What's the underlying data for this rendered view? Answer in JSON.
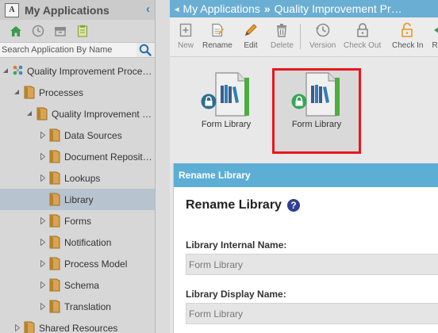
{
  "left_panel": {
    "title": "My Applications",
    "search": {
      "placeholder": "Search Application By Name",
      "value": ""
    },
    "icons": [
      "home-icon",
      "recent-icon",
      "archive-icon",
      "clipboard-icon"
    ],
    "tree": [
      {
        "label": "Quality Improvement Proce…",
        "level": 0,
        "expanded": true,
        "icon": "app-icon"
      },
      {
        "label": "Processes",
        "level": 1,
        "expanded": true,
        "icon": "folder-icon"
      },
      {
        "label": "Quality Improvement …",
        "level": 2,
        "expanded": true,
        "icon": "folder-icon"
      },
      {
        "label": "Data Sources",
        "level": 3,
        "expanded": false,
        "icon": "folder-icon"
      },
      {
        "label": "Document Reposit…",
        "level": 3,
        "expanded": false,
        "icon": "folder-icon"
      },
      {
        "label": "Lookups",
        "level": 3,
        "expanded": false,
        "icon": "folder-icon"
      },
      {
        "label": "Library",
        "level": 3,
        "expanded": null,
        "icon": "folder-icon",
        "selected": true
      },
      {
        "label": "Forms",
        "level": 3,
        "expanded": false,
        "icon": "folder-icon"
      },
      {
        "label": "Notification",
        "level": 3,
        "expanded": false,
        "icon": "folder-icon"
      },
      {
        "label": "Process Model",
        "level": 3,
        "expanded": false,
        "icon": "folder-icon"
      },
      {
        "label": "Schema",
        "level": 3,
        "expanded": false,
        "icon": "folder-icon"
      },
      {
        "label": "Translation",
        "level": 3,
        "expanded": false,
        "icon": "folder-icon"
      },
      {
        "label": "Shared Resources",
        "level": 1,
        "expanded": false,
        "icon": "folder-icon"
      }
    ]
  },
  "breadcrumb": {
    "items": [
      "My Applications",
      "Quality Improvement Pr…"
    ],
    "separator": "»"
  },
  "toolbar": {
    "buttons": [
      {
        "label": "New",
        "icon": "new-icon",
        "enabled": false
      },
      {
        "label": "Rename",
        "icon": "rename-icon",
        "enabled": true
      },
      {
        "label": "Edit",
        "icon": "pencil-icon",
        "enabled": true
      },
      {
        "label": "Delete",
        "icon": "trash-icon",
        "enabled": false
      },
      {
        "label": "Version",
        "icon": "version-icon",
        "enabled": false
      },
      {
        "label": "Check Out",
        "icon": "lock-icon",
        "enabled": false
      },
      {
        "label": "Check In",
        "icon": "unlock-icon",
        "enabled": true
      },
      {
        "label": "R",
        "icon": "arrow-icon",
        "enabled": true
      }
    ]
  },
  "libraries": [
    {
      "caption": "Form Library",
      "selected": false
    },
    {
      "caption": "Form Library",
      "selected": true
    }
  ],
  "dialog": {
    "header": "Rename Library",
    "title": "Rename Library",
    "internal_name_label": "Library Internal Name:",
    "internal_name_value": "Form Library",
    "display_name_label": "Library Display Name:",
    "display_name_value": "Form Library"
  },
  "colors": {
    "breadcrumb_bg": "#6aaed3",
    "dialog_header_bg": "#5daed5",
    "highlight": "#e8171c",
    "selected_row": "#b7c4cf"
  }
}
